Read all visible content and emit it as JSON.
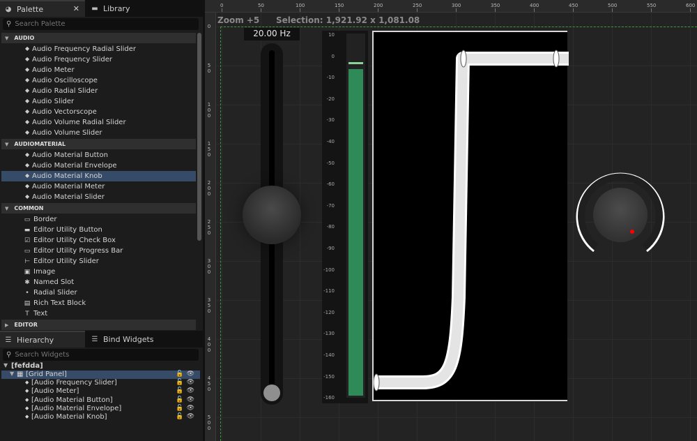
{
  "palette": {
    "tab_label": "Palette",
    "library_label": "Library",
    "search_placeholder": "Search Palette",
    "categories": {
      "audio": "AUDIO",
      "audiomaterial": "AUDIOMATERIAL",
      "common": "COMMON",
      "editor": "EDITOR"
    },
    "audio_items": [
      "Audio Frequency Radial Slider",
      "Audio Frequency Slider",
      "Audio Meter",
      "Audio Oscilloscope",
      "Audio Radial Slider",
      "Audio Slider",
      "Audio Vectorscope",
      "Audio Volume Radial Slider",
      "Audio Volume Slider"
    ],
    "audiomaterial_items": [
      "Audio Material Button",
      "Audio Material Envelope",
      "Audio Material Knob",
      "Audio Material Meter",
      "Audio Material Slider"
    ],
    "common_items": [
      "Border",
      "Editor Utility Button",
      "Editor Utility Check Box",
      "Editor Utility Progress Bar",
      "Editor Utility Slider",
      "Image",
      "Named Slot",
      "Radial Slider",
      "Rich Text Block",
      "Text"
    ],
    "selected_item": "Audio Material Knob"
  },
  "hierarchy": {
    "tab_label": "Hierarchy",
    "bind_label": "Bind Widgets",
    "search_placeholder": "Search Widgets",
    "root": "[fefdda]",
    "grid_panel": "[Grid Panel]",
    "children": [
      "[Audio Frequency Slider]",
      "[Audio Meter]",
      "[Audio Material Button]",
      "[Audio Material Envelope]",
      "[Audio Material Knob]"
    ]
  },
  "designer": {
    "zoom": "Zoom +5",
    "selection": "Selection: 1,921.92 x 1,081.08",
    "ruler_top": [
      "0",
      "50",
      "100",
      "150",
      "200",
      "250",
      "300",
      "350",
      "400",
      "450",
      "500",
      "550",
      "600"
    ],
    "ruler_left": [
      "0",
      "50",
      "100",
      "150",
      "200",
      "250",
      "300",
      "350",
      "400",
      "450",
      "500"
    ],
    "freq_label": "20.00 Hz",
    "meter_labels": [
      "10",
      "0",
      "-10",
      "-20",
      "-30",
      "-40",
      "-50",
      "-60",
      "-70",
      "-80",
      "-90",
      "-100",
      "-110",
      "-120",
      "-130",
      "-140",
      "-150",
      "-160"
    ],
    "colors": {
      "meter_fill": "#2e8b57",
      "selection": "#364b68",
      "knob_dot": "#ff0000"
    }
  }
}
